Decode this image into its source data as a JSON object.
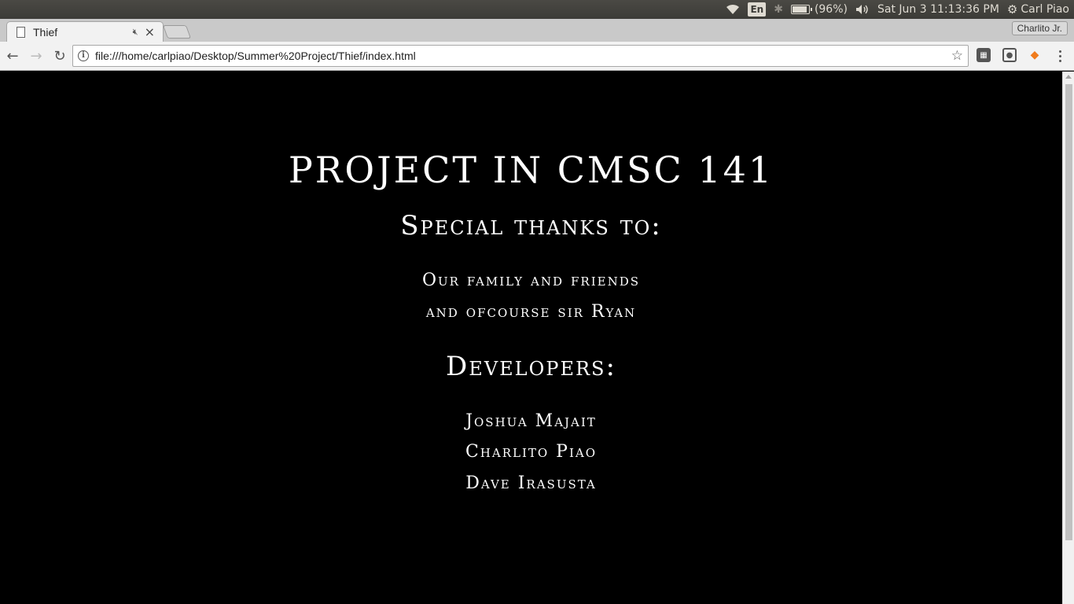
{
  "system_panel": {
    "language": "En",
    "battery": "(96%)",
    "datetime": "Sat Jun  3 11:13:36 PM",
    "user": "Carl Piao"
  },
  "browser": {
    "tab_title": "Thief",
    "profile_name": "Charlito Jr.",
    "url": "file:///home/carlpiao/Desktop/Summer%20Project/Thief/index.html"
  },
  "page": {
    "title": "PROJECT IN CMSC 141",
    "thanks_heading": "Special thanks to:",
    "thanks_lines": [
      "Our family and friends",
      "and ofcourse sir Ryan"
    ],
    "developers_heading": "Developers:",
    "developers": [
      "Joshua Majait",
      "Charlito Piao",
      "Dave Irasusta"
    ]
  },
  "colors": {
    "page_background": "#000000",
    "page_text": "#ffffff"
  }
}
